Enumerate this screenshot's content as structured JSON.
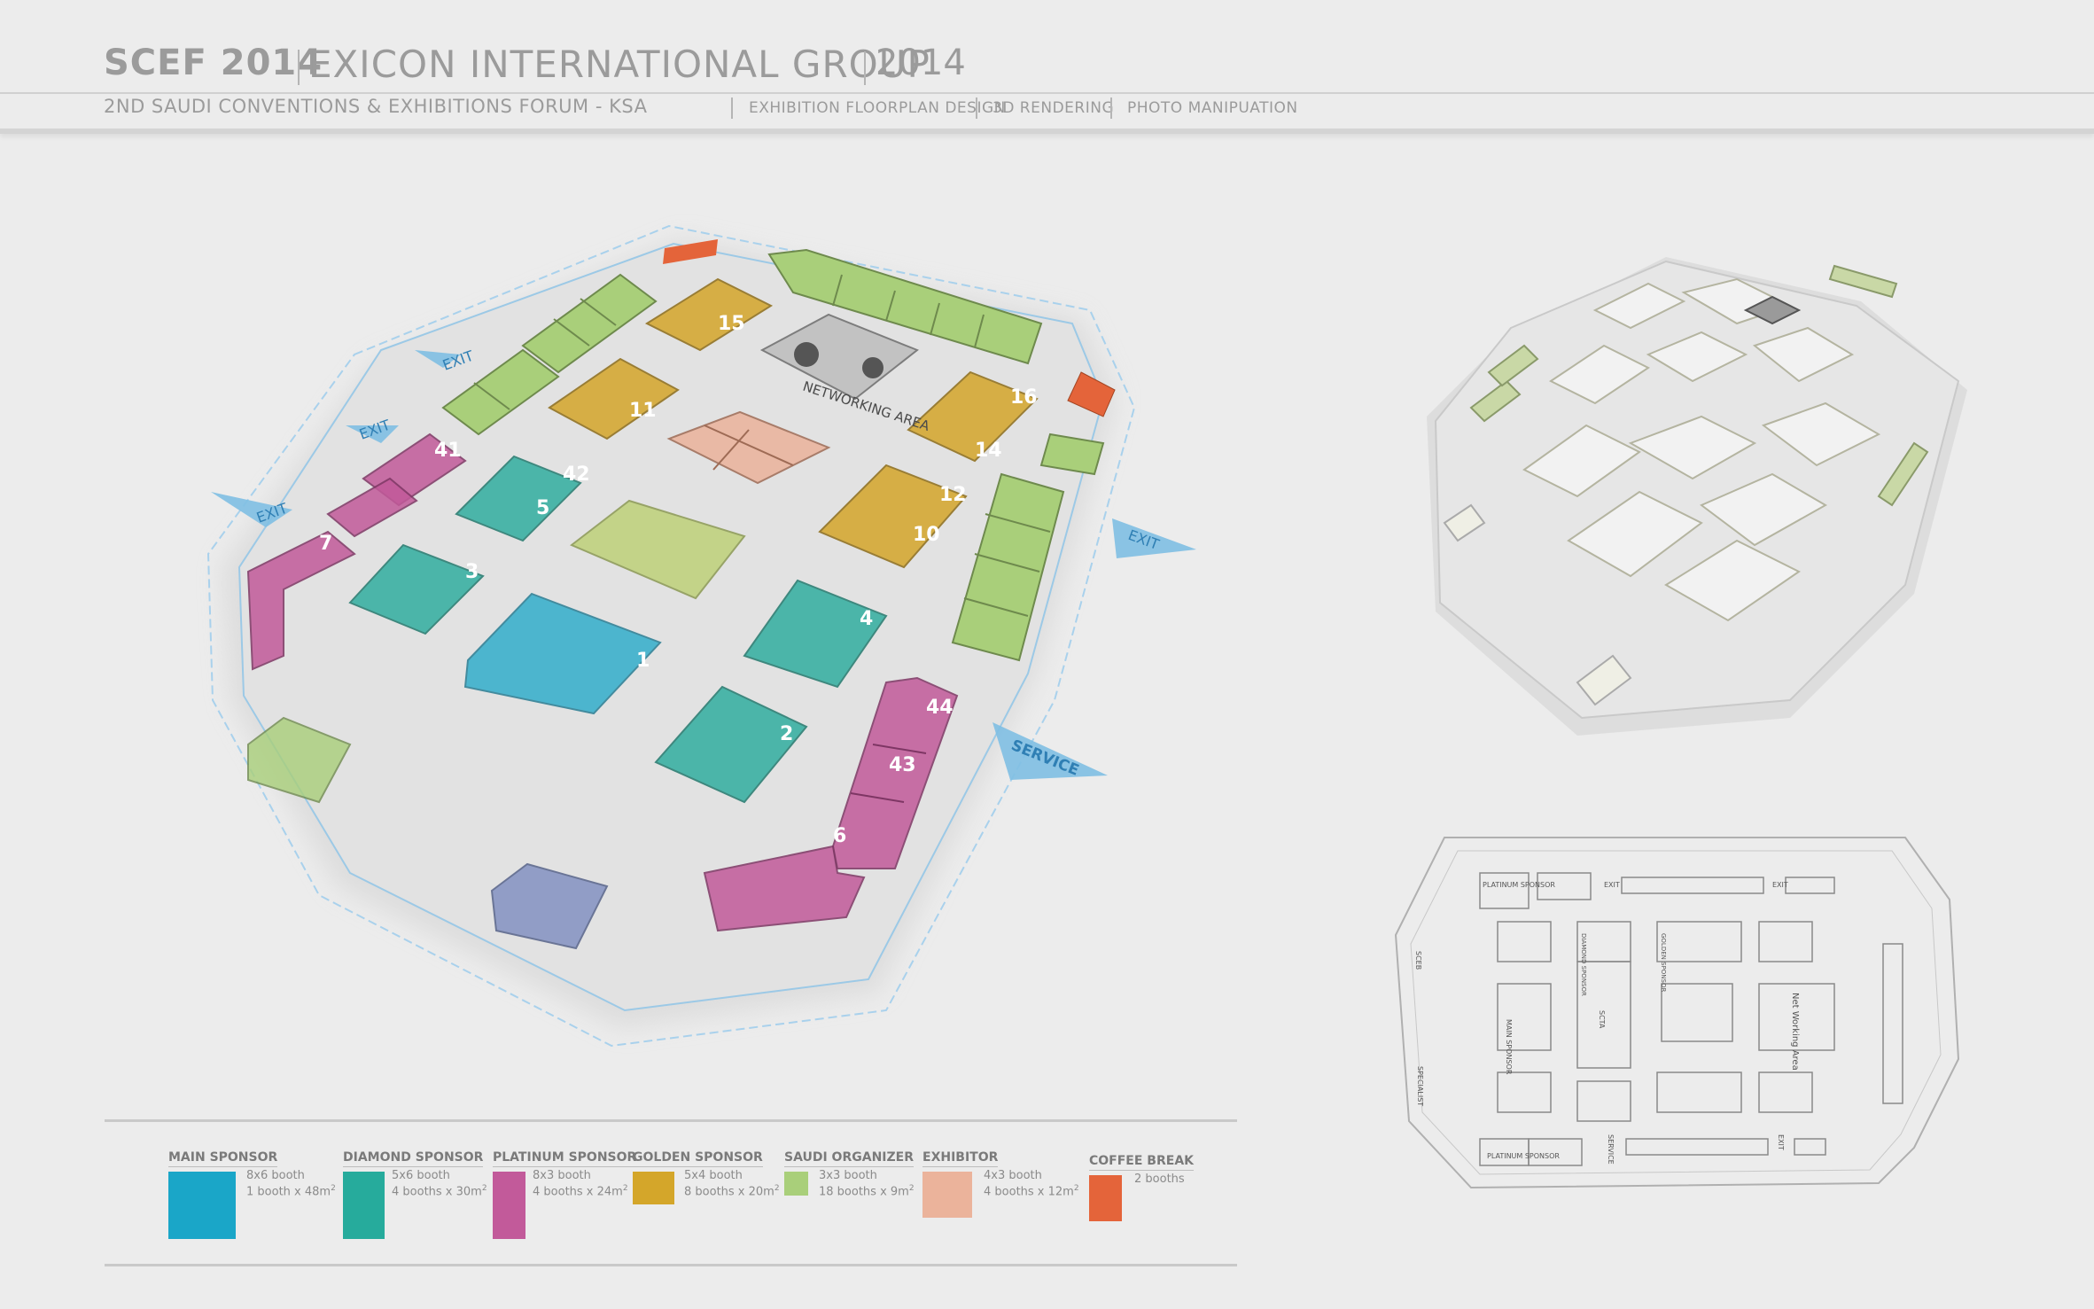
{
  "header": {
    "event": "SCEF 2014",
    "company": "EXICON INTERNATIONAL GROUP",
    "year": "2014",
    "subtitle": "2ND SAUDI CONVENTIONS & EXHIBITIONS FORUM  -  KSA",
    "services": [
      "EXHIBITION FLOORPLAN DESIGN",
      "3D RENDERING",
      "PHOTO MANIPUATION"
    ]
  },
  "colors": {
    "main_sponsor": "#1aa6c8",
    "diamond_sponsor": "#26ab9c",
    "platinum_sponsor": "#c25a9a",
    "golden_sponsor": "#d4a62a",
    "saudi_organizer": "#a9cf7a",
    "exhibitor": "#ebb39b",
    "coffee_break": "#e4643a",
    "arrow": "#7fbfe3"
  },
  "render": {
    "arrows": [
      "EXIT",
      "EXIT",
      "EXIT",
      "EXIT",
      "SERVICE"
    ],
    "networking_label": "NETWORKING AREA",
    "booth_numbers": [
      "1",
      "2",
      "3",
      "4",
      "5",
      "6",
      "7",
      "10",
      "11",
      "12",
      "14",
      "15",
      "16",
      "42",
      "43",
      "44",
      "41"
    ]
  },
  "floorplan": {
    "labels": [
      "PLATINUM SPONSOR",
      "PLATINUM SPONSOR",
      "EXIT",
      "EXIT",
      "MAIN SPONSOR",
      "SCTA",
      "Net Working Area",
      "SERVICE",
      "EXIT",
      "SCEB",
      "SPECIALIST",
      "DIAMOND SPONSOR",
      "GOLDEN SPONSOR"
    ]
  },
  "legend": [
    {
      "title": "MAIN SPONSOR",
      "line1": "8x6 booth",
      "line2": "1 booth x 48m",
      "sup": "2",
      "color_key": "main_sponsor"
    },
    {
      "title": "DIAMOND SPONSOR",
      "line1": "5x6 booth",
      "line2": "4 booths x 30m",
      "sup": "2",
      "color_key": "diamond_sponsor"
    },
    {
      "title": "PLATINUM SPONSOR",
      "line1": "8x3 booth",
      "line2": "4 booths x 24m",
      "sup": "2",
      "color_key": "platinum_sponsor"
    },
    {
      "title": "GOLDEN SPONSOR",
      "line1": "5x4 booth",
      "line2": "8 booths x 20m",
      "sup": "2",
      "color_key": "golden_sponsor"
    },
    {
      "title": "SAUDI ORGANIZER",
      "line1": "3x3 booth",
      "line2": "18 booths x 9m",
      "sup": "2",
      "color_key": "saudi_organizer"
    },
    {
      "title": "EXHIBITOR",
      "line1": "4x3 booth",
      "line2": "4 booths x 12m",
      "sup": "2",
      "color_key": "exhibitor"
    },
    {
      "title": "COFFEE BREAK",
      "line1": "2 booths",
      "line2": "",
      "sup": "",
      "color_key": "coffee_break"
    }
  ]
}
